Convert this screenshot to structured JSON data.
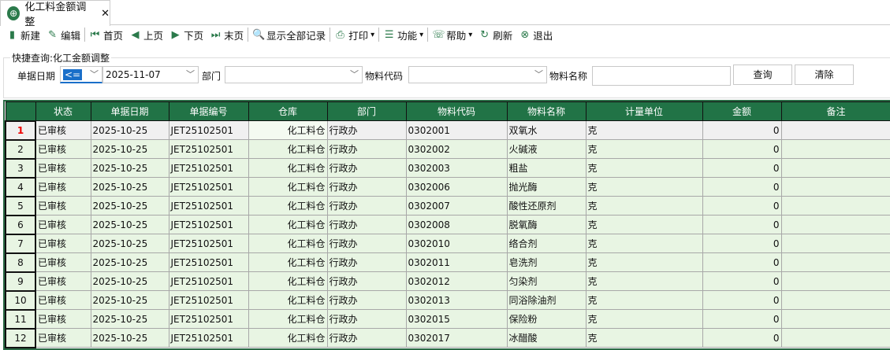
{
  "tab": {
    "title": "化工料金额调整",
    "close": "✕"
  },
  "toolbar": [
    {
      "icon": "new-icon",
      "glyph": "▮",
      "label": "新建"
    },
    {
      "icon": "edit-icon",
      "glyph": "✎",
      "label": "编辑"
    },
    {
      "icon": "first-page-icon",
      "glyph": "⏮",
      "label": "首页"
    },
    {
      "icon": "prev-page-icon",
      "glyph": "◀",
      "label": "上页"
    },
    {
      "icon": "next-page-icon",
      "glyph": "▶",
      "label": "下页"
    },
    {
      "icon": "last-page-icon",
      "glyph": "⏭",
      "label": "末页"
    },
    {
      "icon": "show-all-icon",
      "glyph": "🔍",
      "label": "显示全部记录"
    },
    {
      "icon": "print-icon",
      "glyph": "⎙",
      "label": "打印"
    },
    {
      "icon": "function-icon",
      "glyph": "☰",
      "label": "功能"
    },
    {
      "icon": "help-icon",
      "glyph": "☏",
      "label": "帮助"
    },
    {
      "icon": "refresh-icon",
      "glyph": "↻",
      "label": "刷新"
    },
    {
      "icon": "exit-icon",
      "glyph": "⊗",
      "label": "退出"
    }
  ],
  "query": {
    "legend": "快捷查询:化工金额调整",
    "date_label": "单据日期",
    "op": "<=",
    "date": "2025-11-07",
    "dept_label": "部门",
    "dept": "",
    "code_label": "物料代码",
    "code": "",
    "name_label": "物料名称",
    "name": "",
    "search": "查询",
    "clear": "清除"
  },
  "columns": [
    "",
    "状态",
    "单据日期",
    "单据编号",
    "仓库",
    "部门",
    "物料代码",
    "物料名称",
    "计量单位",
    "金额",
    "备注"
  ],
  "rows": [
    [
      "1",
      "已审核",
      "2025-10-25",
      "JET25102501",
      "化工料仓",
      "行政办",
      "0302001",
      "双氧水",
      "克",
      "0",
      ""
    ],
    [
      "2",
      "已审核",
      "2025-10-25",
      "JET25102501",
      "化工料仓",
      "行政办",
      "0302002",
      "火碱液",
      "克",
      "0",
      ""
    ],
    [
      "3",
      "已审核",
      "2025-10-25",
      "JET25102501",
      "化工料仓",
      "行政办",
      "0302003",
      "粗盐",
      "克",
      "0",
      ""
    ],
    [
      "4",
      "已审核",
      "2025-10-25",
      "JET25102501",
      "化工料仓",
      "行政办",
      "0302006",
      "抛光酶",
      "克",
      "0",
      ""
    ],
    [
      "5",
      "已审核",
      "2025-10-25",
      "JET25102501",
      "化工料仓",
      "行政办",
      "0302007",
      "酸性还原剂",
      "克",
      "0",
      ""
    ],
    [
      "6",
      "已审核",
      "2025-10-25",
      "JET25102501",
      "化工料仓",
      "行政办",
      "0302008",
      "脱氧酶",
      "克",
      "0",
      ""
    ],
    [
      "7",
      "已审核",
      "2025-10-25",
      "JET25102501",
      "化工料仓",
      "行政办",
      "0302010",
      "络合剂",
      "克",
      "0",
      ""
    ],
    [
      "8",
      "已审核",
      "2025-10-25",
      "JET25102501",
      "化工料仓",
      "行政办",
      "0302011",
      "皂洗剂",
      "克",
      "0",
      ""
    ],
    [
      "9",
      "已审核",
      "2025-10-25",
      "JET25102501",
      "化工料仓",
      "行政办",
      "0302012",
      "匀染剂",
      "克",
      "0",
      ""
    ],
    [
      "10",
      "已审核",
      "2025-10-25",
      "JET25102501",
      "化工料仓",
      "行政办",
      "0302013",
      "同浴除油剂",
      "克",
      "0",
      ""
    ],
    [
      "11",
      "已审核",
      "2025-10-25",
      "JET25102501",
      "化工料仓",
      "行政办",
      "0302015",
      "保险粉",
      "克",
      "0",
      ""
    ],
    [
      "12",
      "已审核",
      "2025-10-25",
      "JET25102501",
      "化工料仓",
      "行政办",
      "0302017",
      "冰醋酸",
      "克",
      "0",
      ""
    ]
  ]
}
